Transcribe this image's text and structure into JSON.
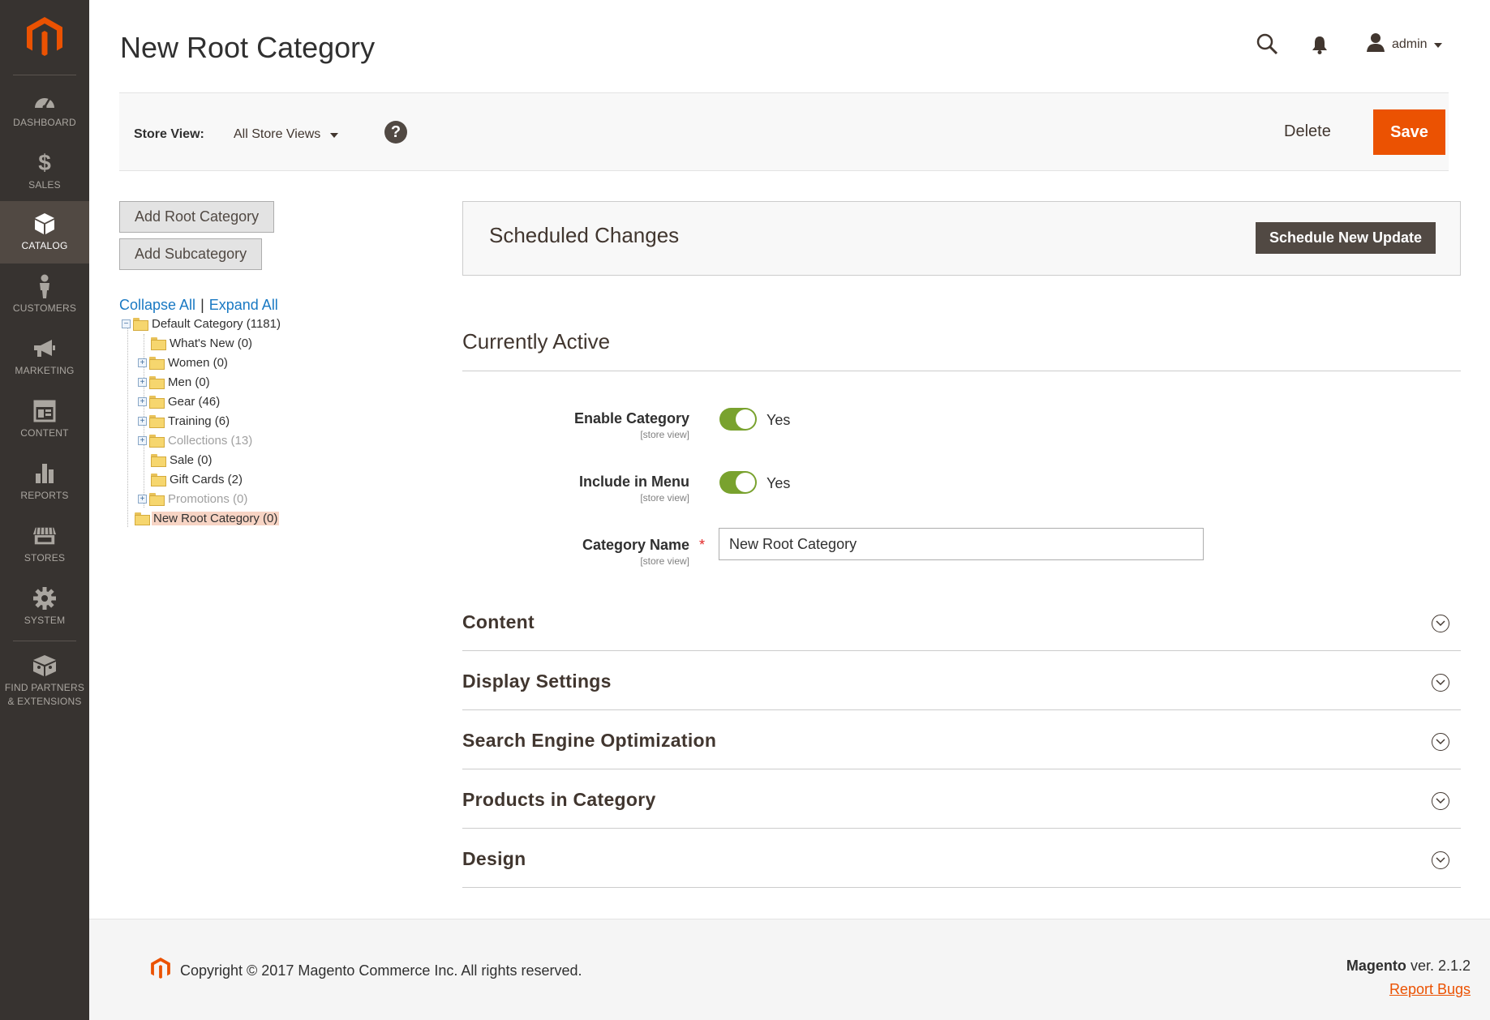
{
  "sidebar": {
    "items": [
      {
        "label": "DASHBOARD",
        "icon": "dashboard-icon"
      },
      {
        "label": "SALES",
        "icon": "dollar-icon"
      },
      {
        "label": "CATALOG",
        "icon": "box-icon"
      },
      {
        "label": "CUSTOMERS",
        "icon": "person-icon"
      },
      {
        "label": "MARKETING",
        "icon": "megaphone-icon"
      },
      {
        "label": "CONTENT",
        "icon": "layout-icon"
      },
      {
        "label": "REPORTS",
        "icon": "bar-chart-icon"
      },
      {
        "label": "STORES",
        "icon": "storefront-icon"
      },
      {
        "label": "SYSTEM",
        "icon": "gear-icon"
      },
      {
        "label_line1": "FIND PARTNERS",
        "label_line2": "& EXTENSIONS",
        "icon": "partners-icon"
      }
    ],
    "active": "CATALOG"
  },
  "header": {
    "title": "New Root Category",
    "user": "admin"
  },
  "toolbar": {
    "store_view_label": "Store View:",
    "store_view_value": "All Store Views",
    "help_label": "?",
    "delete_label": "Delete",
    "save_label": "Save"
  },
  "tree": {
    "add_root_label": "Add Root Category",
    "add_sub_label": "Add Subcategory",
    "collapse_all": "Collapse All",
    "separator": "|",
    "expand_all": "Expand All",
    "nodes": [
      {
        "label": "Default Category (1181)",
        "expander": "−"
      },
      {
        "label": "What's New (0)"
      },
      {
        "label": "Women (0)",
        "expander": "+"
      },
      {
        "label": "Men (0)",
        "expander": "+"
      },
      {
        "label": "Gear (46)",
        "expander": "+"
      },
      {
        "label": "Training (6)",
        "expander": "+"
      },
      {
        "label": "Collections (13)",
        "expander": "+"
      },
      {
        "label": "Sale (0)"
      },
      {
        "label": "Gift Cards (2)"
      },
      {
        "label": "Promotions (0)",
        "expander": "+"
      },
      {
        "label": "New Root Category (0)"
      }
    ]
  },
  "scheduled": {
    "title": "Scheduled Changes",
    "button": "Schedule New Update"
  },
  "active_section": {
    "title": "Currently Active",
    "enable_category": {
      "label": "Enable Category",
      "scope": "[store view]",
      "value": "Yes",
      "on": true
    },
    "include_in_menu": {
      "label": "Include in Menu",
      "scope": "[store view]",
      "value": "Yes",
      "on": true
    },
    "category_name": {
      "label": "Category Name",
      "scope": "[store view]",
      "required_mark": "*",
      "value": "New Root Category"
    }
  },
  "sections": [
    {
      "title": "Content"
    },
    {
      "title": "Display Settings"
    },
    {
      "title": "Search Engine Optimization"
    },
    {
      "title": "Products in Category"
    },
    {
      "title": "Design"
    }
  ],
  "footer": {
    "copyright": "Copyright © 2017 Magento Commerce Inc. All rights reserved.",
    "brand": "Magento",
    "version": "ver. 2.1.2",
    "report_bugs": "Report Bugs"
  },
  "colors": {
    "sidebar_bg": "#373330",
    "sidebar_active": "#514943",
    "accent_orange": "#eb5202",
    "toggle_green": "#79a22e",
    "link_blue": "#1979c3"
  }
}
